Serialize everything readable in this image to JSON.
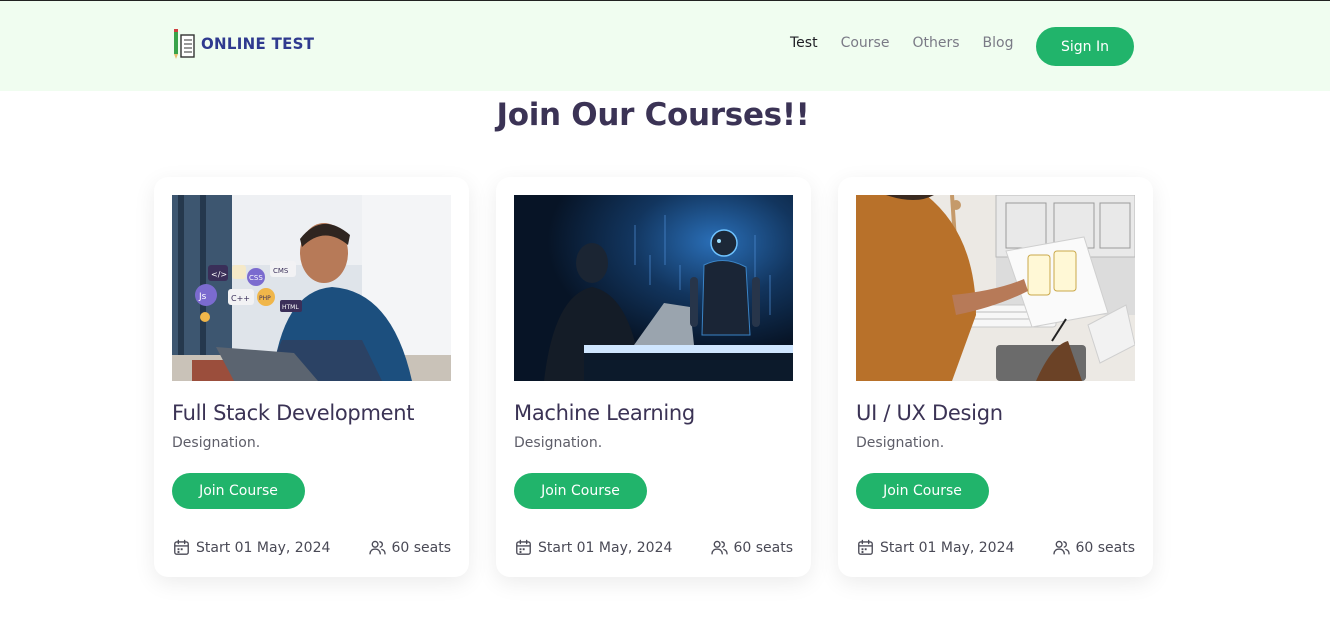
{
  "header": {
    "logo_text": "ONLINE TEST",
    "nav": [
      "Test",
      "Course",
      "Others",
      "Blog"
    ],
    "active_nav": "Test",
    "signin_label": "Sign In"
  },
  "section_title": "Join Our Courses!!",
  "courses": [
    {
      "title": "Full Stack Development",
      "designation": "Designation.",
      "button": "Join Course",
      "start": "Start 01 May, 2024",
      "seats": "60 seats",
      "image_badges": [
        "</>",
        "CMS",
        "CSS",
        "Js",
        "C++",
        "PHP",
        "HTML"
      ]
    },
    {
      "title": "Machine Learning",
      "designation": "Designation.",
      "button": "Join Course",
      "start": "Start 01 May, 2024",
      "seats": "60 seats"
    },
    {
      "title": "UI / UX Design",
      "designation": "Designation.",
      "button": "Join Course",
      "start": "Start 01 May, 2024",
      "seats": "60 seats"
    }
  ],
  "colors": {
    "brand_green": "#21b46b",
    "header_bg": "#f0fdf0",
    "title": "#3b3355",
    "logo_blue": "#2f3a8f"
  },
  "icons": [
    "calendar-icon",
    "users-icon"
  ]
}
